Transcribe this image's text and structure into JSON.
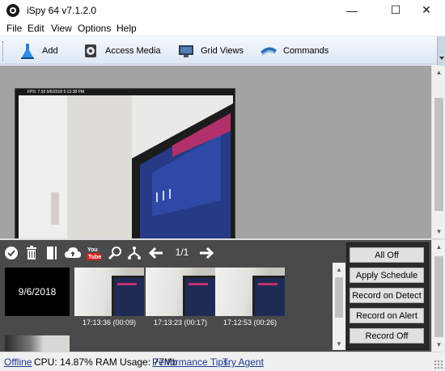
{
  "window": {
    "title": "iSpy 64 v7.1.2.0",
    "minimize_symbol": "—",
    "maximize_symbol": "☐",
    "close_symbol": "✕"
  },
  "menu": [
    "File",
    "Edit",
    "View",
    "Options",
    "Help"
  ],
  "toolbar": {
    "add_label": "Add",
    "access_media_label": "Access Media",
    "grid_views_label": "Grid Views",
    "commands_label": "Commands"
  },
  "camera": {
    "overlay_timestamp": "FPS: 7.55 9/6/2018 5:13:38 PM"
  },
  "media_toolbar": {
    "icons": [
      "check-icon",
      "delete-icon",
      "bookmark-icon",
      "upload-cloud-icon",
      "youtube-icon",
      "search-icon",
      "merge-icon",
      "arrow-left-icon",
      "arrow-right-icon"
    ],
    "page_label": "1/1"
  },
  "media": {
    "date_tile": "9/6/2018",
    "clips": [
      {
        "caption": "17:13:36 (00:09)"
      },
      {
        "caption": "17:13:23 (00:17)"
      },
      {
        "caption": "17:12:53 (00:26)"
      }
    ]
  },
  "commands": {
    "all_off": "All Off",
    "apply_schedule": "Apply Schedule",
    "record_on_detect": "Record on Detect",
    "record_on_alert": "Record on Alert",
    "record_off": "Record Off"
  },
  "status": {
    "offline": "Offline",
    "usage": "CPU: 14.87% RAM Usage: 77Mb",
    "performance_tips": "Performance Tips",
    "try_agent": "Try Agent"
  },
  "colors": {
    "workspace_bg": "#a3a3a3",
    "media_panel_bg": "#4a4a4a",
    "link": "#1a3a8f"
  }
}
